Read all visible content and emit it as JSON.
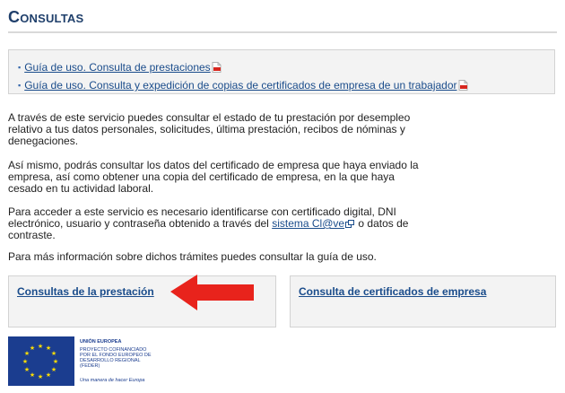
{
  "page": {
    "title": "Consultas"
  },
  "guides": [
    {
      "label": "Guía de uso. Consulta de prestaciones",
      "icon": "pdf-icon"
    },
    {
      "label": "Guía de uso. Consulta y expedición de copias de certificados de empresa de un trabajador",
      "icon": "pdf-icon"
    }
  ],
  "content": {
    "p1": "A través de este servicio puedes consultar el estado de tu prestación por desempleo relativo a tus datos personales, solicitudes, última prestación, recibos de nóminas y denegaciones.",
    "p2": "Así mismo, podrás consultar los datos del certificado de empresa que haya enviado la empresa, así como obtener una copia del certificado de empresa, en la que haya cesado en tu actividad laboral.",
    "p3_before": "Para acceder a este servicio es necesario identificarse con certificado digital, DNI electrónico, usuario y contraseña obtenido a través del ",
    "p3_link": "sistema Cl@ve",
    "p3_after": " o datos de contraste.",
    "p4": "Para más información sobre dichos trámites puedes consultar la guía de uso."
  },
  "cards": {
    "prestacion": "Consultas de la prestación",
    "certificados": "Consulta de certificados de empresa"
  },
  "eu_logo": {
    "line1": "UNIÓN EUROPEA",
    "line2": "PROYECTO COFINANCIADO",
    "line3": "POR EL FONDO EUROPEO DE",
    "line4": "DESARROLLO REGIONAL",
    "line5": "(FEDER)",
    "slogan": "Una manera de hacer Europa"
  },
  "colors": {
    "title": "#1f3f6b",
    "link": "#1a4c8b",
    "arrow": "#e8231c",
    "eu_blue": "#1b3d8f",
    "eu_star": "#ffdd00"
  }
}
